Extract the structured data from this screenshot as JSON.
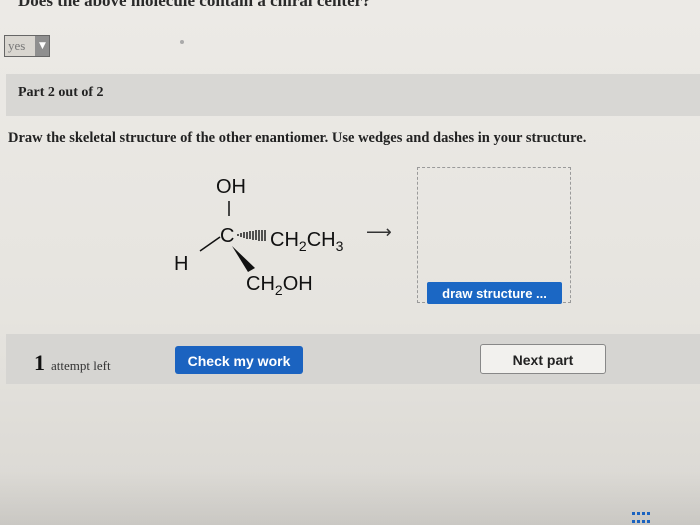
{
  "question": {
    "text": "Does the above molecule contain a chiral center?"
  },
  "answer_dropdown": {
    "selected": "yes"
  },
  "part": {
    "label": "Part 2 out of 2"
  },
  "instructions": "Draw the skeletal structure of the other enantiomer. Use wedges and dashes in your structure.",
  "molecule": {
    "oh": "OH",
    "c": "C",
    "h": "H",
    "right_group_main": "CH",
    "right_group_sub1": "2",
    "right_group_tail": "CH",
    "right_group_sub2": "3",
    "bottom_group_main": "CH",
    "bottom_group_sub": "2",
    "bottom_group_tail": "OH"
  },
  "reaction_arrow": "⟶",
  "draw_structure": {
    "button_label": "draw structure ..."
  },
  "footer": {
    "attempts_count": "1",
    "attempts_label": "attempt left",
    "check_label": "Check my work",
    "next_label": "Next part"
  }
}
